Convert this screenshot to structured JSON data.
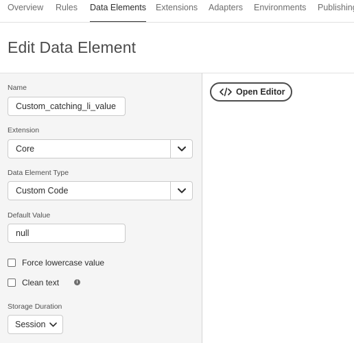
{
  "nav": {
    "tabs": [
      {
        "label": "Overview",
        "active": false
      },
      {
        "label": "Rules",
        "active": false
      },
      {
        "label": "Data Elements",
        "active": true
      },
      {
        "label": "Extensions",
        "active": false
      },
      {
        "label": "Adapters",
        "active": false
      },
      {
        "label": "Environments",
        "active": false
      },
      {
        "label": "Publishing",
        "active": false
      }
    ]
  },
  "page": {
    "title": "Edit Data Element"
  },
  "form": {
    "name": {
      "label": "Name",
      "value": "Custom_catching_li_value"
    },
    "extension": {
      "label": "Extension",
      "value": "Core"
    },
    "data_element_type": {
      "label": "Data Element Type",
      "value": "Custom Code"
    },
    "default_value": {
      "label": "Default Value",
      "value": "null"
    },
    "force_lowercase": {
      "label": "Force lowercase value",
      "checked": false
    },
    "clean_text": {
      "label": "Clean text",
      "checked": false,
      "info_icon": "info-icon",
      "info_glyph": "i"
    },
    "storage_duration": {
      "label": "Storage Duration",
      "value": "Session"
    }
  },
  "editor": {
    "open_editor_label": "Open Editor",
    "icon": "code-icon"
  },
  "colors": {
    "panel_bg": "#f5f5f5",
    "text": "#2c2c2c",
    "muted": "#6e6e6e",
    "border": "#cacaca"
  }
}
